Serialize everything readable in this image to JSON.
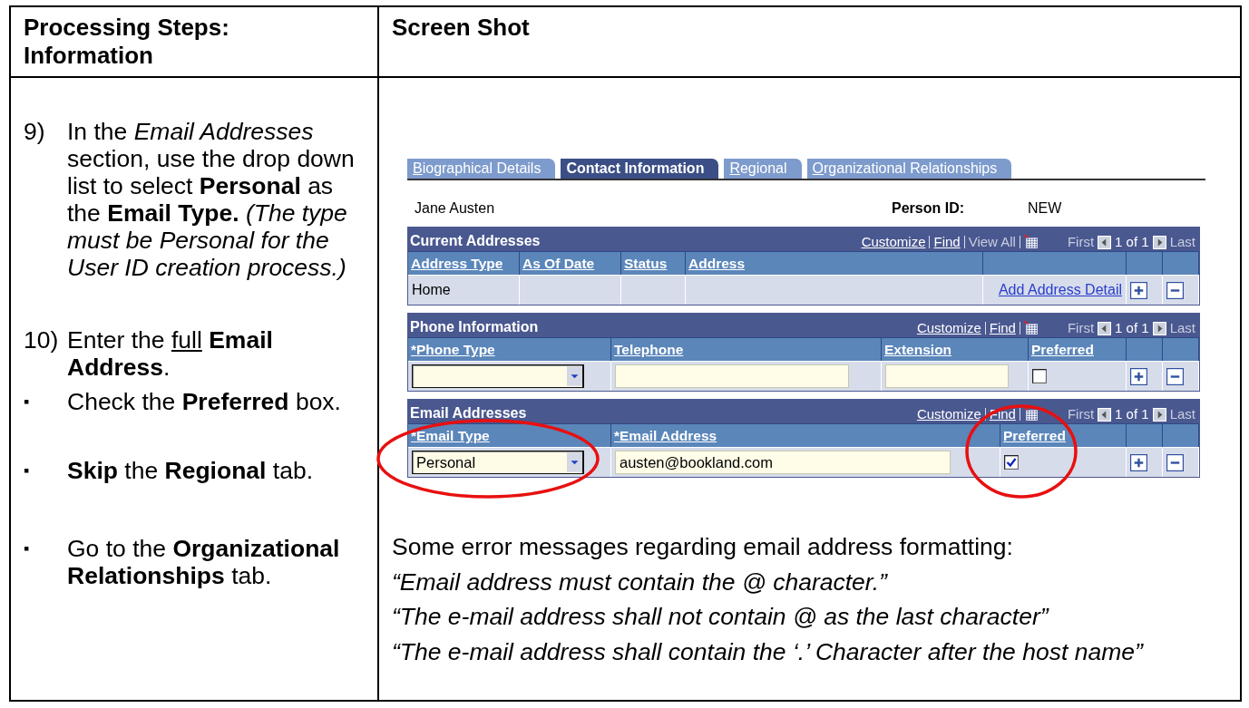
{
  "header": {
    "steps_heading": "Processing Steps: Information",
    "screenshot_heading": "Screen Shot"
  },
  "steps": [
    {
      "kind": "numbered",
      "marker": "9)",
      "segments": [
        {
          "text": "In the ",
          "kind": "plain"
        },
        {
          "text": "Email Addresses",
          "kind": "italic"
        },
        {
          "text": " section, use the drop down list to select ",
          "kind": "plain"
        },
        {
          "text": "Personal",
          "kind": "bold"
        },
        {
          "text": " as the ",
          "kind": "plain"
        },
        {
          "text": "Email Type.",
          "kind": "bold"
        },
        {
          "text": " (The type must be Personal for the User ID creation process.)",
          "kind": "italic"
        }
      ]
    },
    {
      "kind": "numbered",
      "marker": "10)",
      "segments": [
        {
          "text": "Enter the ",
          "kind": "plain"
        },
        {
          "text": "full",
          "kind": "underline"
        },
        {
          "text": " Email Address",
          "kind": "bold"
        },
        {
          "text": ".",
          "kind": "plain"
        }
      ]
    },
    {
      "kind": "bullet",
      "marker": "▪",
      "segments": [
        {
          "text": "Check the ",
          "kind": "plain"
        },
        {
          "text": "Preferred",
          "kind": "bold"
        },
        {
          "text": " box.",
          "kind": "plain"
        }
      ]
    },
    {
      "kind": "bullet",
      "marker": "▪",
      "segments": [
        {
          "text": "Skip",
          "kind": "bold"
        },
        {
          "text": " the ",
          "kind": "plain"
        },
        {
          "text": "Regional",
          "kind": "bold"
        },
        {
          "text": " tab.",
          "kind": "plain"
        }
      ]
    },
    {
      "kind": "bullet",
      "marker": "▪",
      "segments": [
        {
          "text": "Go to the ",
          "kind": "plain"
        },
        {
          "text": "Organizational Relationships",
          "kind": "bold"
        },
        {
          "text": " tab.",
          "kind": "plain"
        }
      ]
    }
  ],
  "screenshot": {
    "tabs": [
      {
        "label": "Biographical Details",
        "selected": false
      },
      {
        "label": "Contact Information",
        "selected": true
      },
      {
        "label": "Regional",
        "selected": false
      },
      {
        "label": "Organizational Relationships",
        "selected": false
      }
    ],
    "person_name": "Jane Austen",
    "person_id_label": "Person ID:",
    "person_id": "NEW",
    "grids": [
      {
        "title": "Current Addresses",
        "toolbar": [
          {
            "label": "Customize",
            "disabled": false
          },
          {
            "label": "Find",
            "disabled": false
          },
          {
            "label": "View All",
            "disabled": true
          }
        ],
        "first": "First",
        "page": "1 of 1",
        "last": "Last",
        "columns": [
          "Address Type",
          "As Of Date",
          "Status",
          "Address"
        ],
        "rows": [
          {
            "cells": [
              {
                "kind": "text",
                "value": "Home"
              },
              {
                "kind": "empty"
              },
              {
                "kind": "empty"
              },
              {
                "kind": "empty"
              },
              {
                "kind": "link",
                "value": "Add Address Detail"
              }
            ]
          }
        ]
      },
      {
        "title": "Phone Information",
        "toolbar": [
          {
            "label": "Customize",
            "disabled": false
          },
          {
            "label": "Find",
            "disabled": false
          }
        ],
        "first": "First",
        "page": "1 of 1",
        "last": "Last",
        "columns": [
          "*Phone Type",
          "Telephone",
          "Extension",
          "Preferred"
        ],
        "rows": [
          {
            "cells": [
              {
                "kind": "dropdown"
              },
              {
                "kind": "input"
              },
              {
                "kind": "input"
              },
              {
                "kind": "checkbox",
                "checked": false
              }
            ]
          }
        ]
      },
      {
        "title": "Email Addresses",
        "toolbar": [
          {
            "label": "Customize",
            "disabled": false
          },
          {
            "label": "Find",
            "disabled": false
          }
        ],
        "first": "First",
        "page": "1 of 1",
        "last": "Last",
        "columns": [
          "*Email Type",
          "*Email Address",
          "Preferred"
        ],
        "rows": [
          {
            "cells": [
              {
                "kind": "dropdown",
                "value": "Personal"
              },
              {
                "kind": "input",
                "value": "austen@bookland.com"
              },
              {
                "kind": "checkbox",
                "checked": true
              }
            ]
          }
        ]
      }
    ]
  },
  "notes": {
    "intro": "Some error messages regarding email address formatting:",
    "messages": [
      "“Email address must contain the @ character.”",
      "“The e-mail address shall not contain @ as the last character”",
      "“The e-mail address shall contain the ‘.’ Character after the host name”"
    ]
  }
}
